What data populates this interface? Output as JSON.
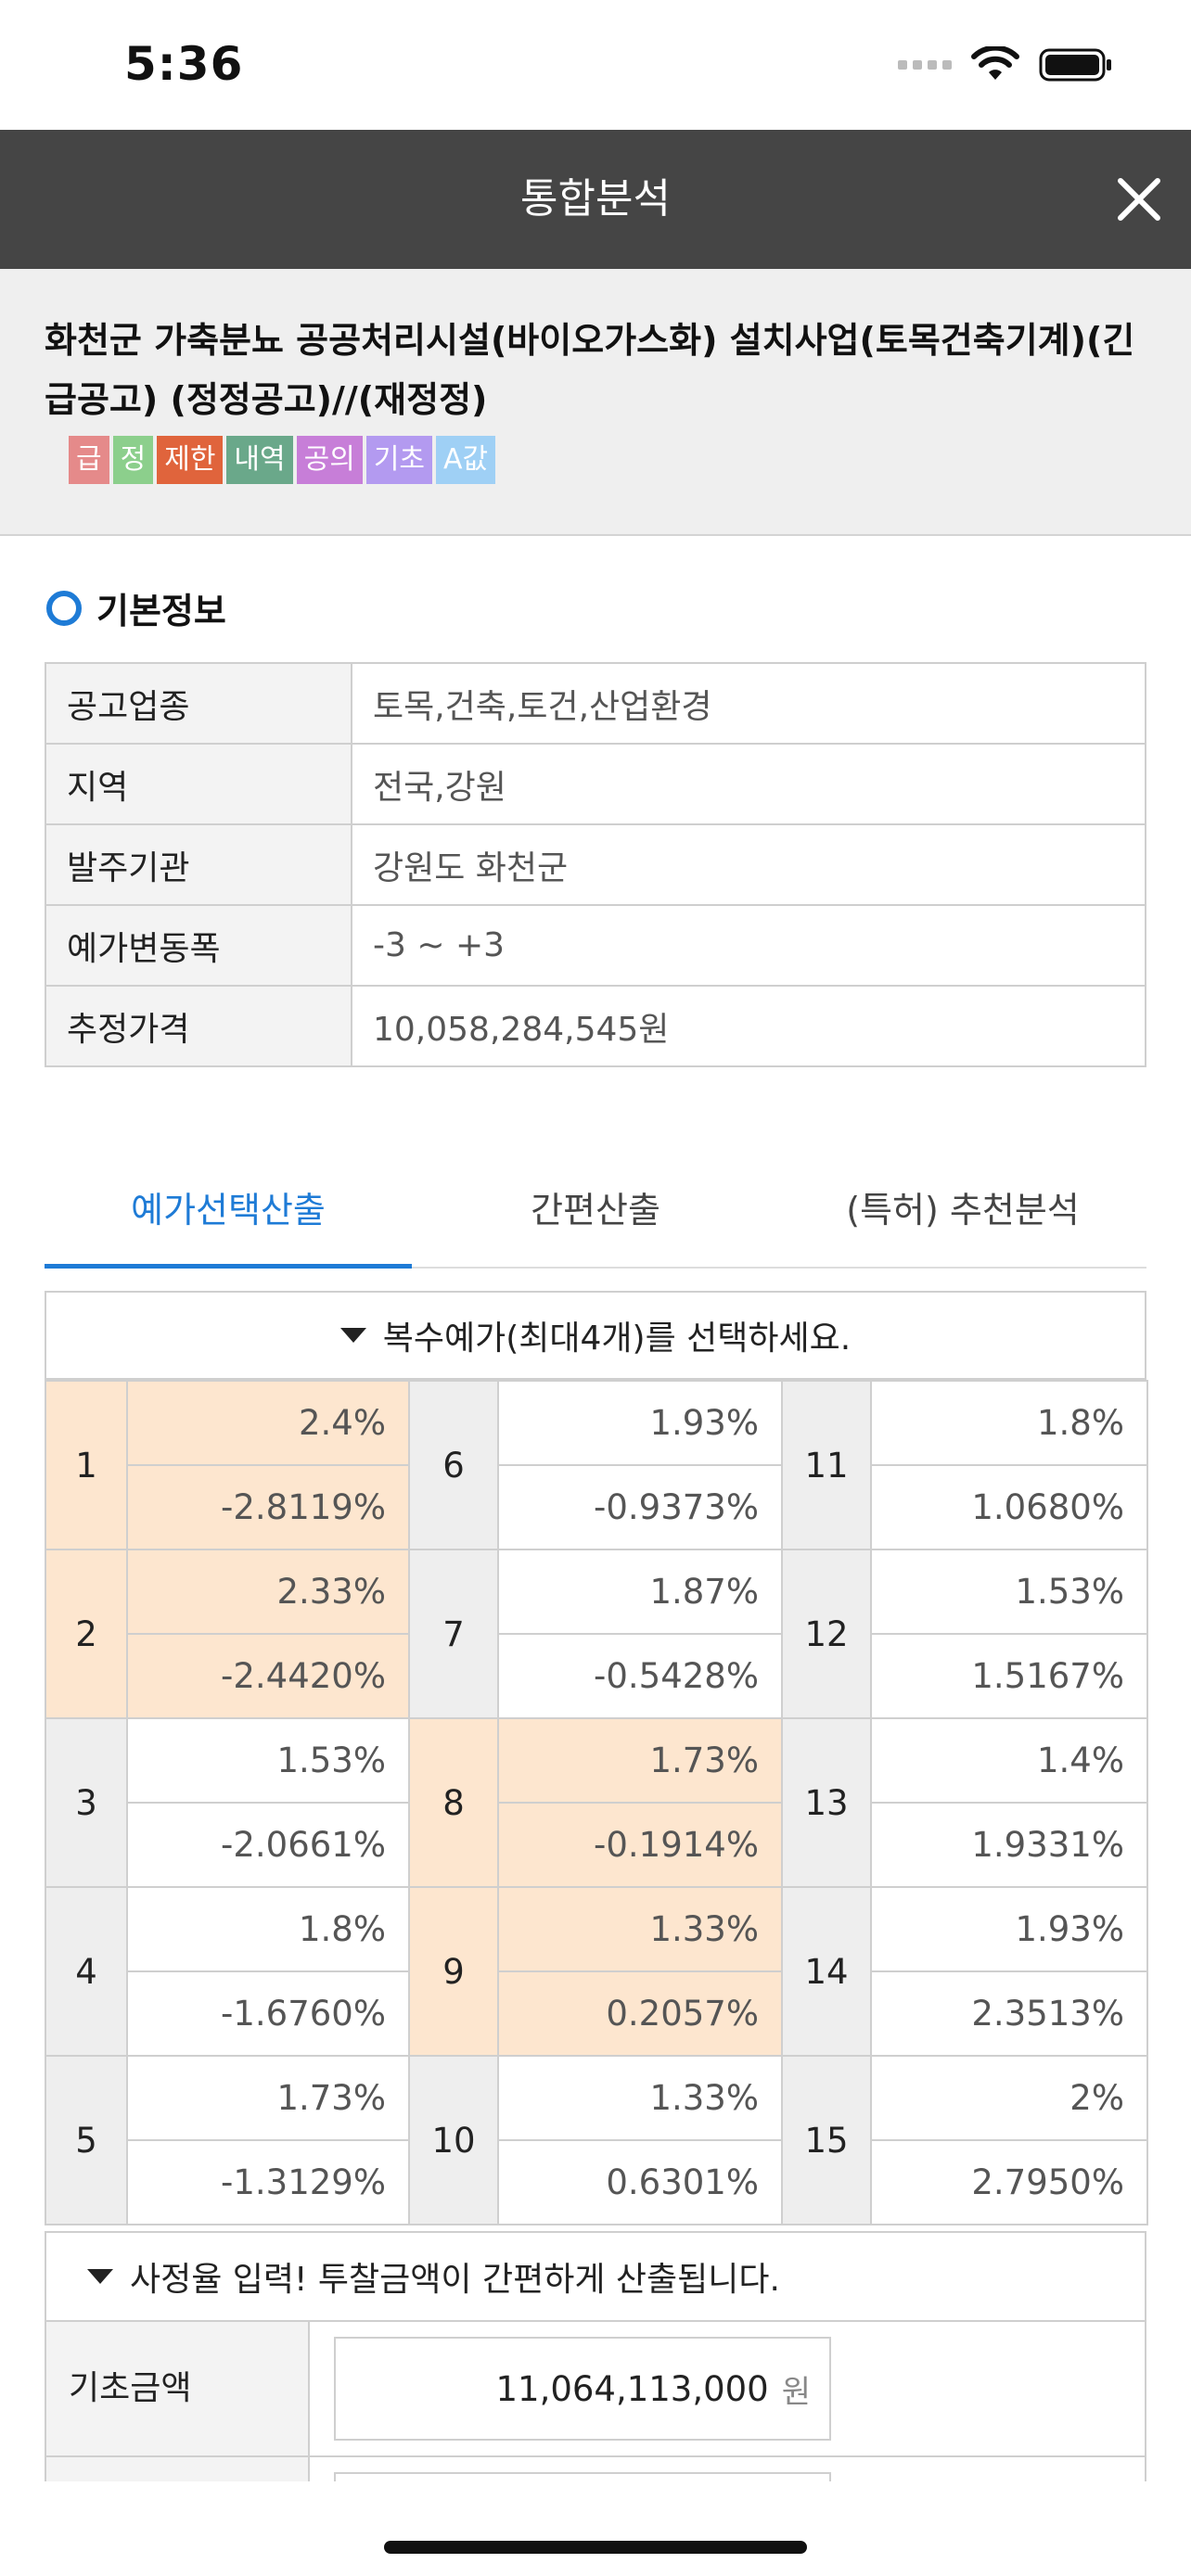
{
  "status_bar": {
    "time": "5:36"
  },
  "header": {
    "title": "통합분석"
  },
  "notice": {
    "title": "화천군 가축분뇨 공공처리시설(바이오가스화) 설치사업(토목건축기계)(긴급공고) (정정공고)//(재정정)",
    "badges": [
      {
        "label": "급",
        "color": "#e58a8a"
      },
      {
        "label": "정",
        "color": "#8ccf8c"
      },
      {
        "label": "제한",
        "color": "#e0643c"
      },
      {
        "label": "내역",
        "color": "#6aa88a"
      },
      {
        "label": "공의",
        "color": "#c77ed8"
      },
      {
        "label": "기초",
        "color": "#b39af0"
      },
      {
        "label": "A값",
        "color": "#9fd0f5"
      }
    ]
  },
  "basic_info": {
    "heading": "기본정보",
    "rows": [
      {
        "key": "공고업종",
        "value": "토목,건축,토건,산업환경"
      },
      {
        "key": "지역",
        "value": "전국,강원"
      },
      {
        "key": "발주기관",
        "value": "강원도 화천군"
      },
      {
        "key": "예가변동폭",
        "value": "-3 ~ +3"
      },
      {
        "key": "추정가격",
        "value": "10,058,284,545원"
      }
    ]
  },
  "tabs": [
    {
      "label": "예가선택산출",
      "active": true
    },
    {
      "label": "간편산출",
      "active": false
    },
    {
      "label": "(특허) 추천분석",
      "active": false
    }
  ],
  "price_grid": {
    "instruction": "복수예가(최대4개)를 선택하세요.",
    "cells": [
      {
        "no": "1",
        "rate": "2.4%",
        "value": "-2.8119%",
        "selected": true
      },
      {
        "no": "2",
        "rate": "2.33%",
        "value": "-2.4420%",
        "selected": true
      },
      {
        "no": "3",
        "rate": "1.53%",
        "value": "-2.0661%",
        "selected": false
      },
      {
        "no": "4",
        "rate": "1.8%",
        "value": "-1.6760%",
        "selected": false
      },
      {
        "no": "5",
        "rate": "1.73%",
        "value": "-1.3129%",
        "selected": false
      },
      {
        "no": "6",
        "rate": "1.93%",
        "value": "-0.9373%",
        "selected": false
      },
      {
        "no": "7",
        "rate": "1.87%",
        "value": "-0.5428%",
        "selected": false
      },
      {
        "no": "8",
        "rate": "1.73%",
        "value": "-0.1914%",
        "selected": true
      },
      {
        "no": "9",
        "rate": "1.33%",
        "value": "0.2057%",
        "selected": true
      },
      {
        "no": "10",
        "rate": "1.33%",
        "value": "0.6301%",
        "selected": false
      },
      {
        "no": "11",
        "rate": "1.8%",
        "value": "1.0680%",
        "selected": false
      },
      {
        "no": "12",
        "rate": "1.53%",
        "value": "1.5167%",
        "selected": false
      },
      {
        "no": "13",
        "rate": "1.4%",
        "value": "1.9331%",
        "selected": false
      },
      {
        "no": "14",
        "rate": "1.93%",
        "value": "2.3513%",
        "selected": false
      },
      {
        "no": "15",
        "rate": "2%",
        "value": "2.7950%",
        "selected": false
      }
    ]
  },
  "calculator": {
    "instruction": "사정율 입력! 투찰금액이 간편하게 산출됩니다.",
    "base_amount_label": "기초금액",
    "base_amount_value": "11,064,113,000",
    "unit": "원"
  },
  "colors": {
    "accent": "#1e7bd6",
    "header_bg": "#454545",
    "selected_cell": "#fde6cf"
  }
}
